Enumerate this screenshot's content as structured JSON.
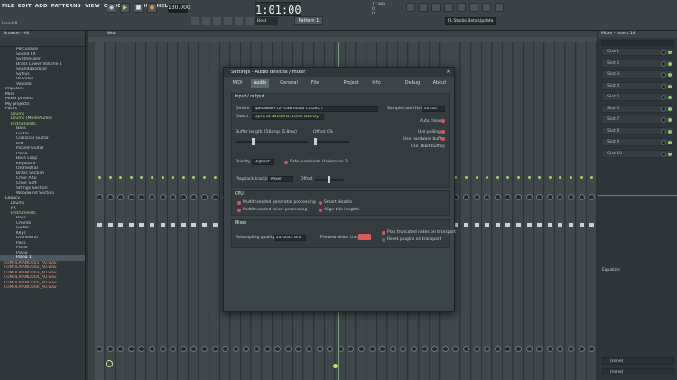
{
  "menu": [
    "FILE",
    "EDIT",
    "ADD",
    "PATTERNS",
    "VIEW",
    "OPTIONS",
    "TOOLS",
    "HELP"
  ],
  "hint": "Insert 8",
  "transport": {
    "bpm": "130.000",
    "time": "1:01:00"
  },
  "toolbar": {
    "snap": "Beat",
    "pattern": "Pattern 1"
  },
  "cpu": {
    "line1": "17 MB",
    "line2": "0",
    "line3": "0"
  },
  "news": "FL Studio Beta Update",
  "browser": {
    "title": "Browser - All",
    "items": [
      {
        "label": "Percussion",
        "level": "l3"
      },
      {
        "label": "Sound FX",
        "level": "l3"
      },
      {
        "label": "Synthesizer",
        "level": "l3"
      },
      {
        "label": "Brass Lower Volume 1",
        "level": "l3"
      },
      {
        "label": "Soundgoodizer",
        "level": "l3"
      },
      {
        "label": "Sytrus",
        "level": "l3"
      },
      {
        "label": "Vocodex",
        "level": "l3"
      },
      {
        "label": "Vocoder",
        "level": "l3"
      },
      {
        "label": "Impulses",
        "level": "l1"
      },
      {
        "label": "Misc",
        "level": "l1"
      },
      {
        "label": "Mixer presets",
        "level": "l1"
      },
      {
        "label": "My projects",
        "level": "l1"
      },
      {
        "label": "Packs",
        "level": "l1"
      },
      {
        "label": "Drums",
        "level": "l2"
      },
      {
        "label": "Drums (ModeAudio)",
        "level": "l2"
      },
      {
        "label": "Instruments",
        "level": "l2"
      },
      {
        "label": "Bass",
        "level": "l3"
      },
      {
        "label": "Guitar",
        "level": "l3"
      },
      {
        "label": "Classical Guitar",
        "level": "l3"
      },
      {
        "label": "Riff",
        "level": "l3"
      },
      {
        "label": "Picked Guitar",
        "level": "l3"
      },
      {
        "label": "Piano",
        "level": "l3"
      },
      {
        "label": "Bass Loop",
        "level": "l3"
      },
      {
        "label": "Keyboard",
        "level": "l3"
      },
      {
        "label": "Orchestral",
        "level": "l3"
      },
      {
        "label": "Brass Section",
        "level": "l3"
      },
      {
        "label": "Choir Alto",
        "level": "l3"
      },
      {
        "label": "Choir Soft",
        "level": "l3"
      },
      {
        "label": "Strings Section",
        "level": "l3"
      },
      {
        "label": "Woodwind Section",
        "level": "l3"
      },
      {
        "label": "Legacy",
        "level": "l1"
      },
      {
        "label": "Drums",
        "level": "l2"
      },
      {
        "label": "FX",
        "level": "l2"
      },
      {
        "label": "Instruments",
        "level": "l2"
      },
      {
        "label": "Bass",
        "level": "l3"
      },
      {
        "label": "Chords",
        "level": "l3"
      },
      {
        "label": "Guitar",
        "level": "l3"
      },
      {
        "label": "Keys",
        "level": "l3"
      },
      {
        "label": "Orchestral",
        "level": "l3"
      },
      {
        "label": "Pads",
        "level": "l3"
      },
      {
        "label": "Piano",
        "level": "l3"
      },
      {
        "label": "Piano",
        "level": "l3"
      },
      {
        "label": "Piano 1",
        "level": "l3"
      },
      {
        "label": "CUMULPIANO001_A0.wav",
        "level": "file"
      },
      {
        "label": "CUMULPIANO002_A0.wav",
        "level": "file"
      },
      {
        "label": "CUMULPIANO003_A0.wav",
        "level": "file"
      },
      {
        "label": "CUMULPIANO004_A0.wav",
        "level": "file"
      },
      {
        "label": "CUMULPIANO005_A0.wav",
        "level": "file"
      },
      {
        "label": "CUMULPIANO006_A0.wav",
        "level": "file"
      }
    ]
  },
  "playlist": {
    "title": "Web"
  },
  "mixer": {
    "panel_title": "Mixer - Insert 14",
    "strip_count": 48
  },
  "rightpanel": {
    "slots": [
      "Slot 1",
      "Slot 2",
      "Slot 3",
      "Slot 4",
      "Slot 5",
      "Slot 6",
      "Slot 7",
      "Slot 8",
      "Slot 9",
      "Slot 10"
    ],
    "eq_label": "Equalizer",
    "out1": "(none)",
    "out2": "(none)"
  },
  "dialog": {
    "title": "Settings - Audio devices / mixer",
    "tabs": [
      "MIDI",
      "Audio",
      "General",
      "File",
      "Project",
      "Info",
      "Debug",
      "About"
    ],
    "active_tab": "Audio",
    "io": {
      "section": "Input / output",
      "device_label": "Device",
      "device_value": "Динамики (2- USB Audio CODEC )",
      "sample_rate_label": "Sample rate (Hz)",
      "sample_rate_value": "44100",
      "status_label": "Status",
      "status_value": "Open at 44100Hz, 10ms latency",
      "auto_close": "Auto close",
      "buffer_label": "Buffer length 256smp (5.8ms)",
      "offset_label": "Offset 0%",
      "use_polling": "Use polling",
      "use_hw_buffer": "Use hardware buffer",
      "use_16bit": "Use 16bit buffer",
      "priority_label": "Priority",
      "priority_value": "Highest",
      "safe_overloads": "Safe overloads",
      "underruns": "Underruns 3",
      "playback_label": "Playback tracking",
      "playback_value": "Mixer",
      "pb_offset_label": "Offset"
    },
    "cpu": {
      "section": "CPU",
      "multi_gen": "Multithreaded generator processing",
      "multi_mix": "Multithreaded mixer processing",
      "smart_disable": "Smart disable",
      "align_tick": "Align tick lengths"
    },
    "mixer": {
      "section": "Mixer",
      "resampling_label": "Resampling quality",
      "resampling_value": "24-point sinc",
      "preview_label": "Preview mixer track",
      "preview_value": "--",
      "play_truncated": "Play truncated notes on transport",
      "reset_plugins": "Reset plugins on transport"
    }
  },
  "colors": {
    "accent_red": "#e15a54",
    "accent_green": "#9cd65a",
    "bg": "#2a3135"
  }
}
